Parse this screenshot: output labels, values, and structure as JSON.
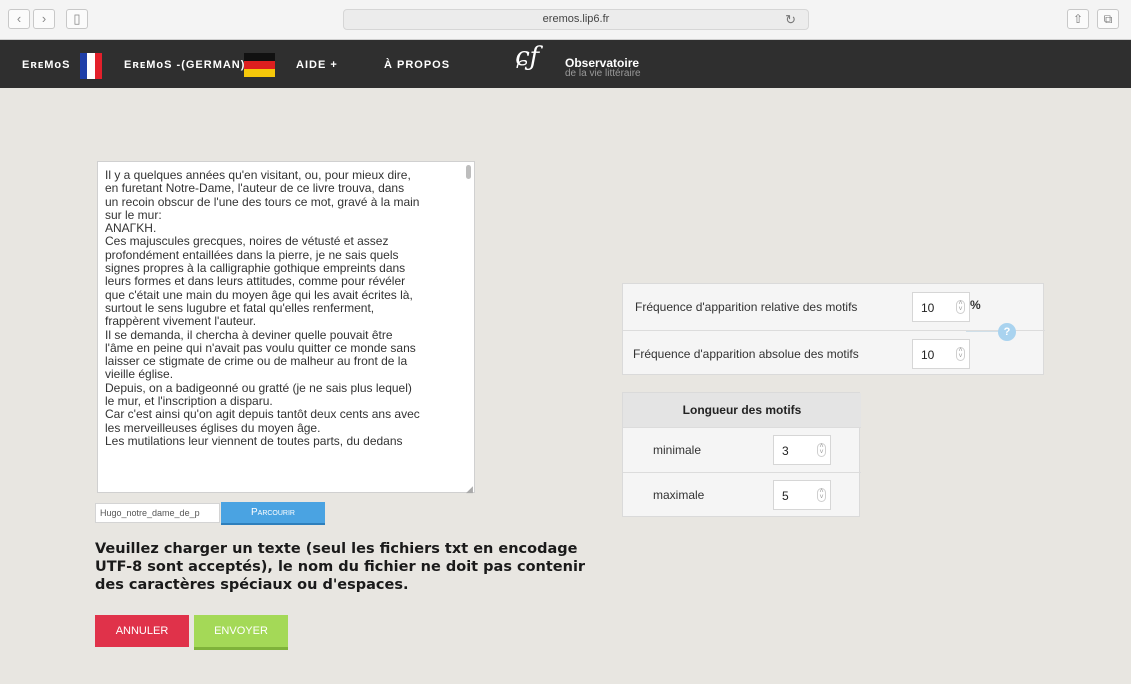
{
  "browser": {
    "url": "eremos.lip6.fr",
    "back_icon": "chevron-left",
    "forward_icon": "chevron-right",
    "sidebar_icon": "sidebar",
    "reload_icon": "reload",
    "share_icon": "share",
    "tabs_icon": "tabs"
  },
  "nav": {
    "eremos": "EʀᴇMᴏS",
    "eremos_german": "EʀᴇMᴏS -(GERMAN)",
    "aide": "AIDE +",
    "apropos": "À PROPOS",
    "logo_title": "Observatoire",
    "logo_subtitle": "de la vie littéraire",
    "flag_fr_colors": [
      "#1f3fa8",
      "#ffffff",
      "#e3202b"
    ],
    "flag_de_colors": [
      "#111111",
      "#dd1f1f",
      "#f6c80a"
    ]
  },
  "text_area": {
    "lines": [
      "Il y a quelques années qu'en visitant, ou, pour mieux dire,",
      "en furetant Notre-Dame, l'auteur de ce livre trouva, dans",
      "un recoin obscur de l'une des tours ce mot, gravé à la main",
      "sur le mur:",
      "ΑΝΑΓΚΗ.",
      "Ces majuscules grecques, noires de vétusté et assez",
      "profondément entaillées dans la pierre, je ne sais quels",
      "signes propres à la calligraphie gothique empreints dans",
      "leurs formes et dans leurs attitudes, comme pour révéler",
      "que c'était une main du moyen âge qui les avait écrites là,",
      "surtout le sens lugubre et fatal qu'elles renferment,",
      "frappèrent vivement l'auteur.",
      "Il se demanda, il chercha à deviner quelle pouvait être",
      "l'âme en peine qui n'avait pas voulu quitter ce monde sans",
      "laisser ce stigmate de crime ou de malheur au front de la",
      "vieille église.",
      "Depuis, on a badigeonné ou gratté (je ne sais plus lequel)",
      "le mur, et l'inscription a disparu.",
      "Car c'est ainsi qu'on agit depuis tantôt deux cents ans avec",
      "les merveilleuses églises du moyen âge.",
      "Les mutilations leur viennent de toutes parts, du dedans"
    ]
  },
  "upload": {
    "file_name": "Hugo_notre_dame_de_p",
    "browse_label": "Parcourir",
    "instructions": "Veuillez charger un texte (seul les fichiers txt en encodage UTF-8 sont acceptés), le nom du fichier ne doit pas contenir des caractères spéciaux ou d'espaces.",
    "cancel_label": "ANNULER",
    "send_label": "ENVOYER",
    "cancel_color": "#e0324a",
    "send_color": "#a4d957",
    "browse_color": "#4aa3e2"
  },
  "frequency": {
    "relative_label": "Fréquence d'apparition relative des motifs",
    "relative_value": "10",
    "relative_unit": "%",
    "absolute_label": "Fréquence d'apparition absolue des motifs",
    "absolute_value": "10",
    "help_label": "?"
  },
  "length": {
    "header": "Longueur des motifs",
    "min_label": "minimale",
    "min_value": "3",
    "max_label": "maximale",
    "max_value": "5"
  }
}
